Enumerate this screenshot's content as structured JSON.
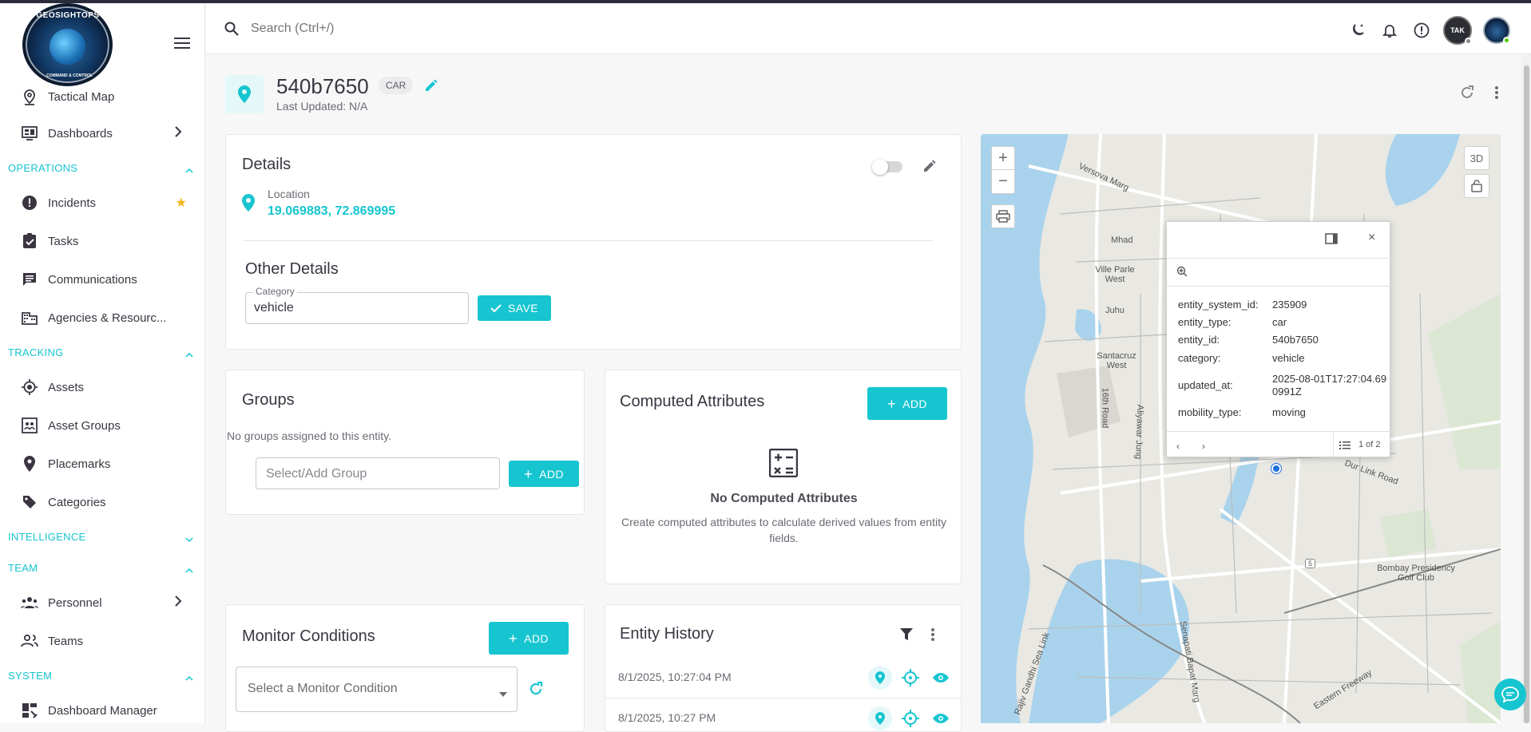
{
  "brand": {
    "logo_text": "GEOSIGHTOPS",
    "logo_subtext": "COMMAND & CONTROL"
  },
  "sidebar": {
    "items_top": [
      {
        "label": "Tactical Map",
        "icon": "map-pin-person-icon"
      },
      {
        "label": "Dashboards",
        "icon": "dashboard-icon"
      }
    ],
    "sections": [
      {
        "title": "OPERATIONS",
        "expanded": true,
        "items": [
          {
            "label": "Incidents",
            "icon": "alert-circle-icon",
            "starred": true
          },
          {
            "label": "Tasks",
            "icon": "task-check-icon"
          },
          {
            "label": "Communications",
            "icon": "chat-icon"
          },
          {
            "label": "Agencies & Resourc...",
            "icon": "building-icon"
          }
        ]
      },
      {
        "title": "TRACKING",
        "expanded": true,
        "items": [
          {
            "label": "Assets",
            "icon": "target-icon"
          },
          {
            "label": "Asset Groups",
            "icon": "group-box-icon"
          },
          {
            "label": "Placemarks",
            "icon": "pin-icon"
          },
          {
            "label": "Categories",
            "icon": "tag-icon"
          }
        ]
      },
      {
        "title": "INTELLIGENCE",
        "expanded": false,
        "items": []
      },
      {
        "title": "TEAM",
        "expanded": true,
        "items": [
          {
            "label": "Personnel",
            "icon": "people-icon"
          },
          {
            "label": "Teams",
            "icon": "team-icon"
          }
        ]
      },
      {
        "title": "SYSTEM",
        "expanded": true,
        "items": [
          {
            "label": "Dashboard Manager",
            "icon": "dashboard-manager-icon"
          }
        ]
      }
    ]
  },
  "search": {
    "placeholder": "Search (Ctrl+/)"
  },
  "top_icons": [
    "dark-mode-icon",
    "bell-icon",
    "info-icon"
  ],
  "avatar_tak_text": "TAK",
  "entity": {
    "title": "540b7650",
    "type_chip": "CAR",
    "last_updated": "Last Updated: N/A"
  },
  "details": {
    "title": "Details",
    "location_label": "Location",
    "location_value": "19.069883, 72.869995",
    "other_title": "Other Details",
    "category_label": "Category",
    "category_value": "vehicle",
    "save_label": "SAVE"
  },
  "groups": {
    "title": "Groups",
    "empty_text": "No groups assigned to this entity.",
    "select_placeholder": "Select/Add Group",
    "add_label": "ADD"
  },
  "computed": {
    "title": "Computed Attributes",
    "add_label": "ADD",
    "empty_title": "No Computed Attributes",
    "empty_desc": "Create computed attributes to calculate derived values from entity fields."
  },
  "monitor": {
    "title": "Monitor Conditions",
    "add_label": "ADD",
    "select_placeholder": "Select a Monitor Condition"
  },
  "history": {
    "title": "Entity History",
    "rows": [
      {
        "date": "8/1/2025, 10:27:04 PM"
      },
      {
        "date": "8/1/2025, 10:27 PM"
      }
    ]
  },
  "map": {
    "btn_3d": "3D",
    "popup": {
      "rows": [
        {
          "key": "entity_system_id:",
          "value": "235909"
        },
        {
          "key": "entity_type:",
          "value": "car"
        },
        {
          "key": "entity_id:",
          "value": "540b7650"
        },
        {
          "key": "category:",
          "value": "vehicle"
        },
        {
          "key": "updated_at:",
          "value": "2025-08-01T17:27:04.690991Z"
        },
        {
          "key": "mobility_type:",
          "value": "moving"
        }
      ],
      "pager": "1 of 2"
    },
    "labels": [
      "Versova Marg",
      "Mhad",
      "Ville Parle West",
      "Juhu",
      "Santacruz West",
      "16th Road",
      "Aliyawar Jung",
      "Bombay Presidency Golf Club",
      "Eastern Freeway",
      "Rajiv Gandhi Sea Link",
      "Senapati Bapat Marg",
      "Dur Link Road",
      "5"
    ]
  },
  "colors": {
    "accent": "#16c5d0",
    "star": "#f5b21a",
    "text": "#3a3541"
  }
}
